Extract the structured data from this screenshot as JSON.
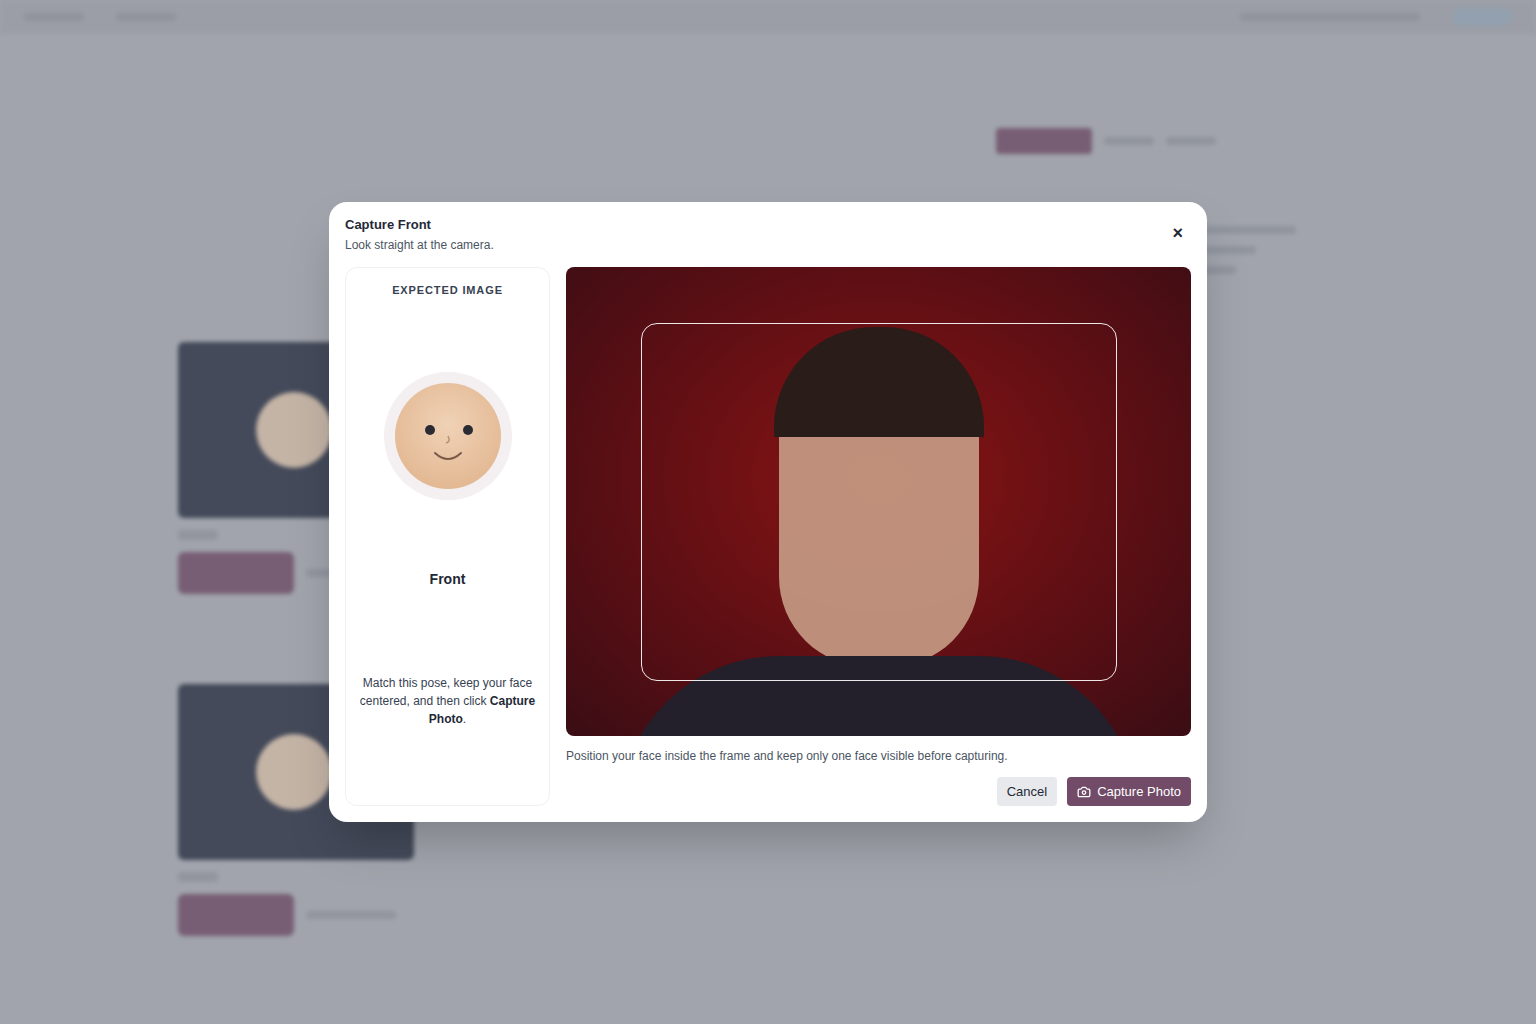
{
  "dialog": {
    "title": "Capture Front",
    "subtitle": "Look straight at the camera.",
    "close": "×"
  },
  "expected": {
    "heading": "EXPECTED IMAGE",
    "pose": "Front",
    "instructions_prefix": "Match this pose, keep your face centered, and then click ",
    "instructions_bold": "Capture Photo",
    "instructions_suffix": "."
  },
  "camera": {
    "hint": "Position your face inside the frame and keep only one face visible before capturing."
  },
  "buttons": [
    {
      "label": "Cancel",
      "kind": "secondary"
    },
    {
      "label": "Capture Photo",
      "kind": "primary"
    }
  ]
}
